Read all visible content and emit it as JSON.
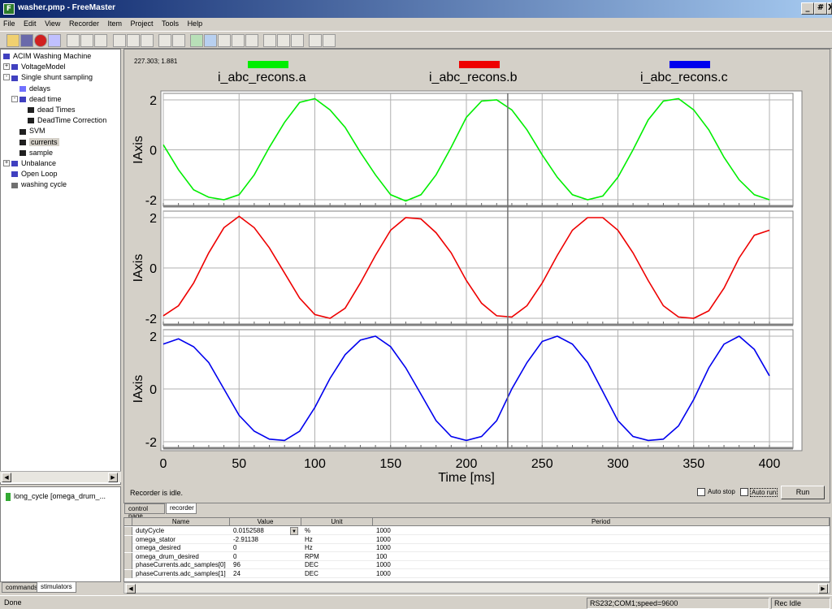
{
  "window": {
    "title": "washer.pmp - FreeMaster",
    "controls": [
      "_",
      "#",
      "X"
    ]
  },
  "menu": [
    "File",
    "Edit",
    "View",
    "Recorder",
    "Item",
    "Project",
    "Tools",
    "Help"
  ],
  "tree": [
    {
      "label": "ACIM Washing Machine",
      "indent": 0,
      "expander": ""
    },
    {
      "label": "VoltageModel",
      "indent": 1,
      "expander": "+"
    },
    {
      "label": "Single shunt sampling",
      "indent": 1,
      "expander": "-"
    },
    {
      "label": "delays",
      "indent": 2,
      "expander": ""
    },
    {
      "label": "dead time",
      "indent": 2,
      "expander": "-"
    },
    {
      "label": "dead Times",
      "indent": 3,
      "expander": ""
    },
    {
      "label": "DeadTime Correction",
      "indent": 3,
      "expander": ""
    },
    {
      "label": "SVM",
      "indent": 2,
      "expander": ""
    },
    {
      "label": "currents",
      "indent": 2,
      "expander": "",
      "selected": true
    },
    {
      "label": "sample",
      "indent": 2,
      "expander": ""
    },
    {
      "label": "Unbalance",
      "indent": 1,
      "expander": "+"
    },
    {
      "label": "Open Loop",
      "indent": 1,
      "expander": ""
    },
    {
      "label": "washing cycle",
      "indent": 1,
      "expander": ""
    }
  ],
  "stimulator": {
    "item": "long_cycle [omega_drum_..."
  },
  "left_tabs": [
    "commands",
    "stimulators"
  ],
  "recorder": {
    "cursor_readout": "227.303; 1.881",
    "status": "Recorder is idle.",
    "auto_stop": "Auto stop",
    "auto_run": "Auto run",
    "run_button": "Run"
  },
  "center_tabs": [
    "control page",
    "recorder"
  ],
  "watch": {
    "columns": [
      "Name",
      "Value",
      "Unit",
      "Period"
    ],
    "rows": [
      {
        "name": "dutyCycle",
        "value": "0.0152588",
        "unit": "%",
        "period": "1000"
      },
      {
        "name": "omega_stator",
        "value": "-2.91138",
        "unit": "Hz",
        "period": "1000"
      },
      {
        "name": "omega_desired",
        "value": "0",
        "unit": "Hz",
        "period": "1000"
      },
      {
        "name": "omega_drum_desired",
        "value": "0",
        "unit": "RPM",
        "period": "100"
      },
      {
        "name": "phaseCurrents.adc_samples[0]",
        "value": "96",
        "unit": "DEC",
        "period": "1000"
      },
      {
        "name": "phaseCurrents.adc_samples[1]",
        "value": "24",
        "unit": "DEC",
        "period": "1000"
      }
    ]
  },
  "statusbar": {
    "left": "Done",
    "comm": "RS232;COM1;speed=9600",
    "rec": "Rec Idle"
  },
  "colors": {
    "a": "#00ee00",
    "b": "#ee0000",
    "c": "#0000ee"
  },
  "chart_data": {
    "type": "line",
    "xlabel": "Time [ms]",
    "ylabel": "IAxis",
    "xlim": [
      0,
      400
    ],
    "xticks": [
      0,
      50,
      100,
      150,
      200,
      250,
      300,
      350,
      400
    ],
    "ylim": [
      -2,
      2
    ],
    "yticks": [
      -2,
      0,
      2
    ],
    "cursor_x": 227.303,
    "series": [
      {
        "name": "i_abc_recons.a",
        "x": [
          0,
          10,
          20,
          30,
          40,
          50,
          60,
          70,
          80,
          90,
          100,
          110,
          120,
          130,
          140,
          150,
          160,
          170,
          180,
          190,
          200,
          210,
          220,
          230,
          240,
          250,
          260,
          270,
          280,
          290,
          300,
          310,
          320,
          330,
          340,
          350,
          360,
          370,
          380,
          390,
          400
        ],
        "values": [
          0.2,
          -0.8,
          -1.6,
          -1.9,
          -2.0,
          -1.8,
          -1.0,
          0.1,
          1.1,
          1.9,
          2.05,
          1.6,
          0.9,
          -0.1,
          -1.0,
          -1.8,
          -2.05,
          -1.8,
          -1.0,
          0.1,
          1.3,
          1.95,
          2.0,
          1.6,
          0.8,
          -0.2,
          -1.1,
          -1.8,
          -2.0,
          -1.85,
          -1.1,
          0.0,
          1.2,
          1.95,
          2.05,
          1.6,
          0.8,
          -0.3,
          -1.2,
          -1.8,
          -2.0
        ]
      },
      {
        "name": "i_abc_recons.b",
        "x": [
          0,
          10,
          20,
          30,
          40,
          50,
          60,
          70,
          80,
          90,
          100,
          110,
          120,
          130,
          140,
          150,
          160,
          170,
          180,
          190,
          200,
          210,
          220,
          230,
          240,
          250,
          260,
          270,
          280,
          290,
          300,
          310,
          320,
          330,
          340,
          350,
          360,
          370,
          380,
          390,
          400
        ],
        "values": [
          -1.9,
          -1.5,
          -0.6,
          0.6,
          1.6,
          2.05,
          1.6,
          0.8,
          -0.2,
          -1.2,
          -1.85,
          -2.0,
          -1.6,
          -0.6,
          0.5,
          1.5,
          2.0,
          1.95,
          1.4,
          0.6,
          -0.5,
          -1.4,
          -1.9,
          -1.95,
          -1.5,
          -0.6,
          0.5,
          1.5,
          2.0,
          2.0,
          1.5,
          0.6,
          -0.5,
          -1.5,
          -1.95,
          -2.0,
          -1.7,
          -0.8,
          0.4,
          1.3,
          1.5
        ]
      },
      {
        "name": "i_abc_recons.c",
        "x": [
          0,
          10,
          20,
          30,
          40,
          50,
          60,
          70,
          80,
          90,
          100,
          110,
          120,
          130,
          140,
          150,
          160,
          170,
          180,
          190,
          200,
          210,
          220,
          230,
          240,
          250,
          260,
          270,
          280,
          290,
          300,
          310,
          320,
          330,
          340,
          350,
          360,
          370,
          380,
          390,
          400
        ],
        "values": [
          1.7,
          1.9,
          1.6,
          1.0,
          0.0,
          -1.0,
          -1.6,
          -1.9,
          -1.95,
          -1.6,
          -0.7,
          0.4,
          1.3,
          1.85,
          2.0,
          1.6,
          0.8,
          -0.2,
          -1.2,
          -1.8,
          -1.95,
          -1.8,
          -1.2,
          0.0,
          1.0,
          1.8,
          2.0,
          1.7,
          1.0,
          -0.1,
          -1.2,
          -1.8,
          -1.95,
          -1.9,
          -1.4,
          -0.4,
          0.8,
          1.7,
          2.0,
          1.5,
          0.5
        ]
      }
    ]
  }
}
